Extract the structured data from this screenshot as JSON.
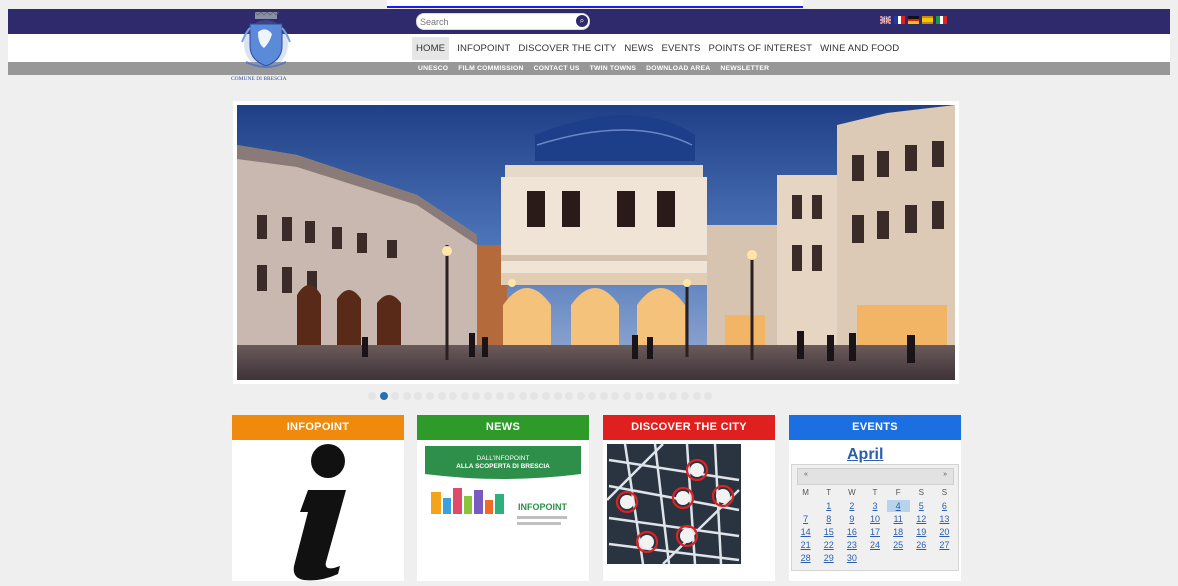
{
  "header": {
    "search_placeholder": "Search",
    "languages": [
      "en",
      "fr",
      "de",
      "es",
      "it"
    ]
  },
  "logo": {
    "text": "COMUNE DI BRESCIA"
  },
  "main_nav": [
    {
      "label": "HOME",
      "active": true
    },
    {
      "label": "INFOPOINT"
    },
    {
      "label": "DISCOVER THE CITY"
    },
    {
      "label": "NEWS"
    },
    {
      "label": "EVENTS"
    },
    {
      "label": "POINTS OF INTEREST"
    },
    {
      "label": "WINE AND FOOD"
    }
  ],
  "sub_nav": [
    "UNESCO",
    "FILM COMMISSION",
    "CONTACT US",
    "TWIN TOWNS",
    "DOWNLOAD AREA",
    "NEWSLETTER"
  ],
  "slider": {
    "total_dots": 30,
    "active_index": 1
  },
  "cards": [
    {
      "title": "INFOPOINT",
      "color": "#ef8a0c"
    },
    {
      "title": "NEWS",
      "color": "#2e9a2a",
      "image_text": [
        "DALL'INFOPOINT",
        "ALLA SCOPERTA DI BRESCIA",
        "INFOPOINT"
      ]
    },
    {
      "title": "DISCOVER THE CITY",
      "color": "#e0201e"
    },
    {
      "title": "EVENTS",
      "color": "#1c6fe0"
    }
  ],
  "calendar": {
    "month": "April",
    "prev": "«",
    "next": "»",
    "weekdays": [
      "M",
      "T",
      "W",
      "T",
      "F",
      "S",
      "S"
    ],
    "weeks": [
      [
        "",
        "1",
        "2",
        "3",
        "4",
        "5",
        "6",
        "7"
      ],
      [
        "8",
        "9",
        "10",
        "11",
        "12",
        "13",
        "14"
      ],
      [
        "15",
        "16",
        "17",
        "18",
        "19",
        "20",
        "21"
      ],
      [
        "22",
        "23",
        "24",
        "25",
        "26",
        "27",
        "28"
      ],
      [
        "29",
        "30"
      ]
    ],
    "highlight": "4"
  },
  "colors": {
    "header_bg": "#2e2a6b",
    "subnav_bg": "#979797",
    "page_bg": "#efefef"
  }
}
